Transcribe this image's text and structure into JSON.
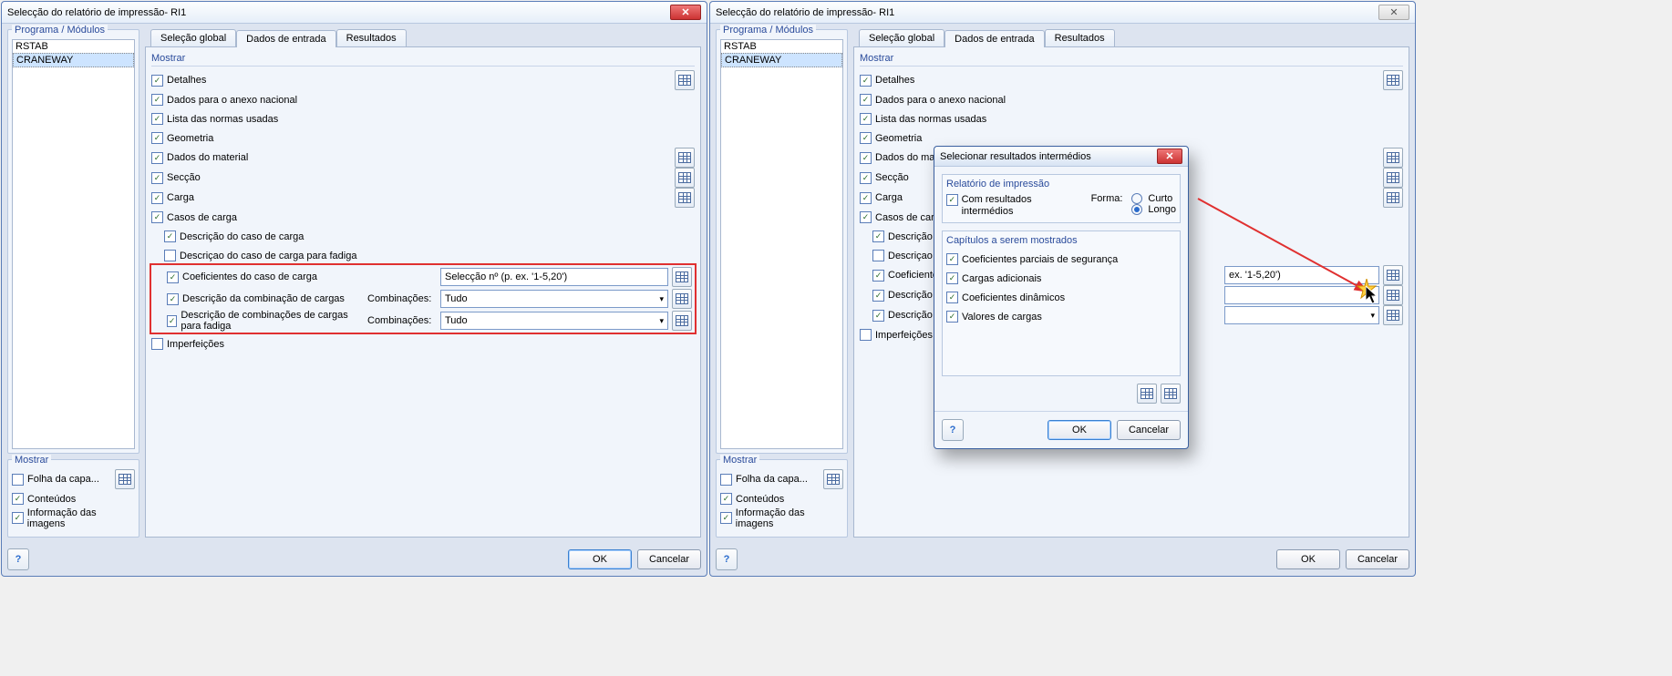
{
  "window_title": "Selecção do relatório de impressão- RI1",
  "left": {
    "modules_title": "Programa / Módulos",
    "modules": [
      "RSTAB",
      "CRANEWAY"
    ],
    "mostrar_title": "Mostrar",
    "folha": "Folha da capa...",
    "conteudos": "Conteúdos",
    "informacao": "Informação das imagens"
  },
  "tabs": {
    "global": "Seleção global",
    "entrada": "Dados de entrada",
    "resultados": "Resultados"
  },
  "show": {
    "title": "Mostrar",
    "detalhes": "Detalhes",
    "anexo": "Dados para o anexo nacional",
    "normas": "Lista das normas usadas",
    "geometria": "Geometria",
    "material": "Dados do material",
    "seccao": "Secção",
    "carga": "Carga",
    "casos": "Casos de carga",
    "desc_caso": "Descrição do caso de carga",
    "desc_fadiga": "Descriçao do caso de carga para fadiga",
    "coef_caso": "Coeficientes do caso de carga",
    "seleccao_n": "Selecção nº (p. ex. '1-5,20')",
    "desc_comb": "Descrição da combinação de cargas",
    "comb_label": "Combinações:",
    "tudo": "Tudo",
    "desc_comb_fad": "Descrição de combinações de cargas para fadiga",
    "imperf": "Imperfeições",
    "right_short": {
      "material": "Dados do materi",
      "casos": "Casos de carga",
      "desc_caso": "Descrição do",
      "desc_fadiga": "Descriçao do",
      "coef_caso": "Coeficientes",
      "desc_comb": "Descrição d",
      "desc_comb_fad": "Descrição de"
    }
  },
  "buttons": {
    "ok": "OK",
    "cancel": "Cancelar"
  },
  "sub": {
    "title": "Selecionar resultados intermédios",
    "rel_title": "Relatório de impressão",
    "com_res": "Com resultados intermédios",
    "forma": "Forma:",
    "curto": "Curto",
    "longo": "Longo",
    "cap_title": "Capítulos a serem mostrados",
    "cp1": "Coeficientes parciais de segurança",
    "cp2": "Cargas adicionais",
    "cp3": "Coeficientes dinâmicos",
    "cp4": "Valores de cargas"
  },
  "right_combo_hint": "ex. '1-5,20')"
}
